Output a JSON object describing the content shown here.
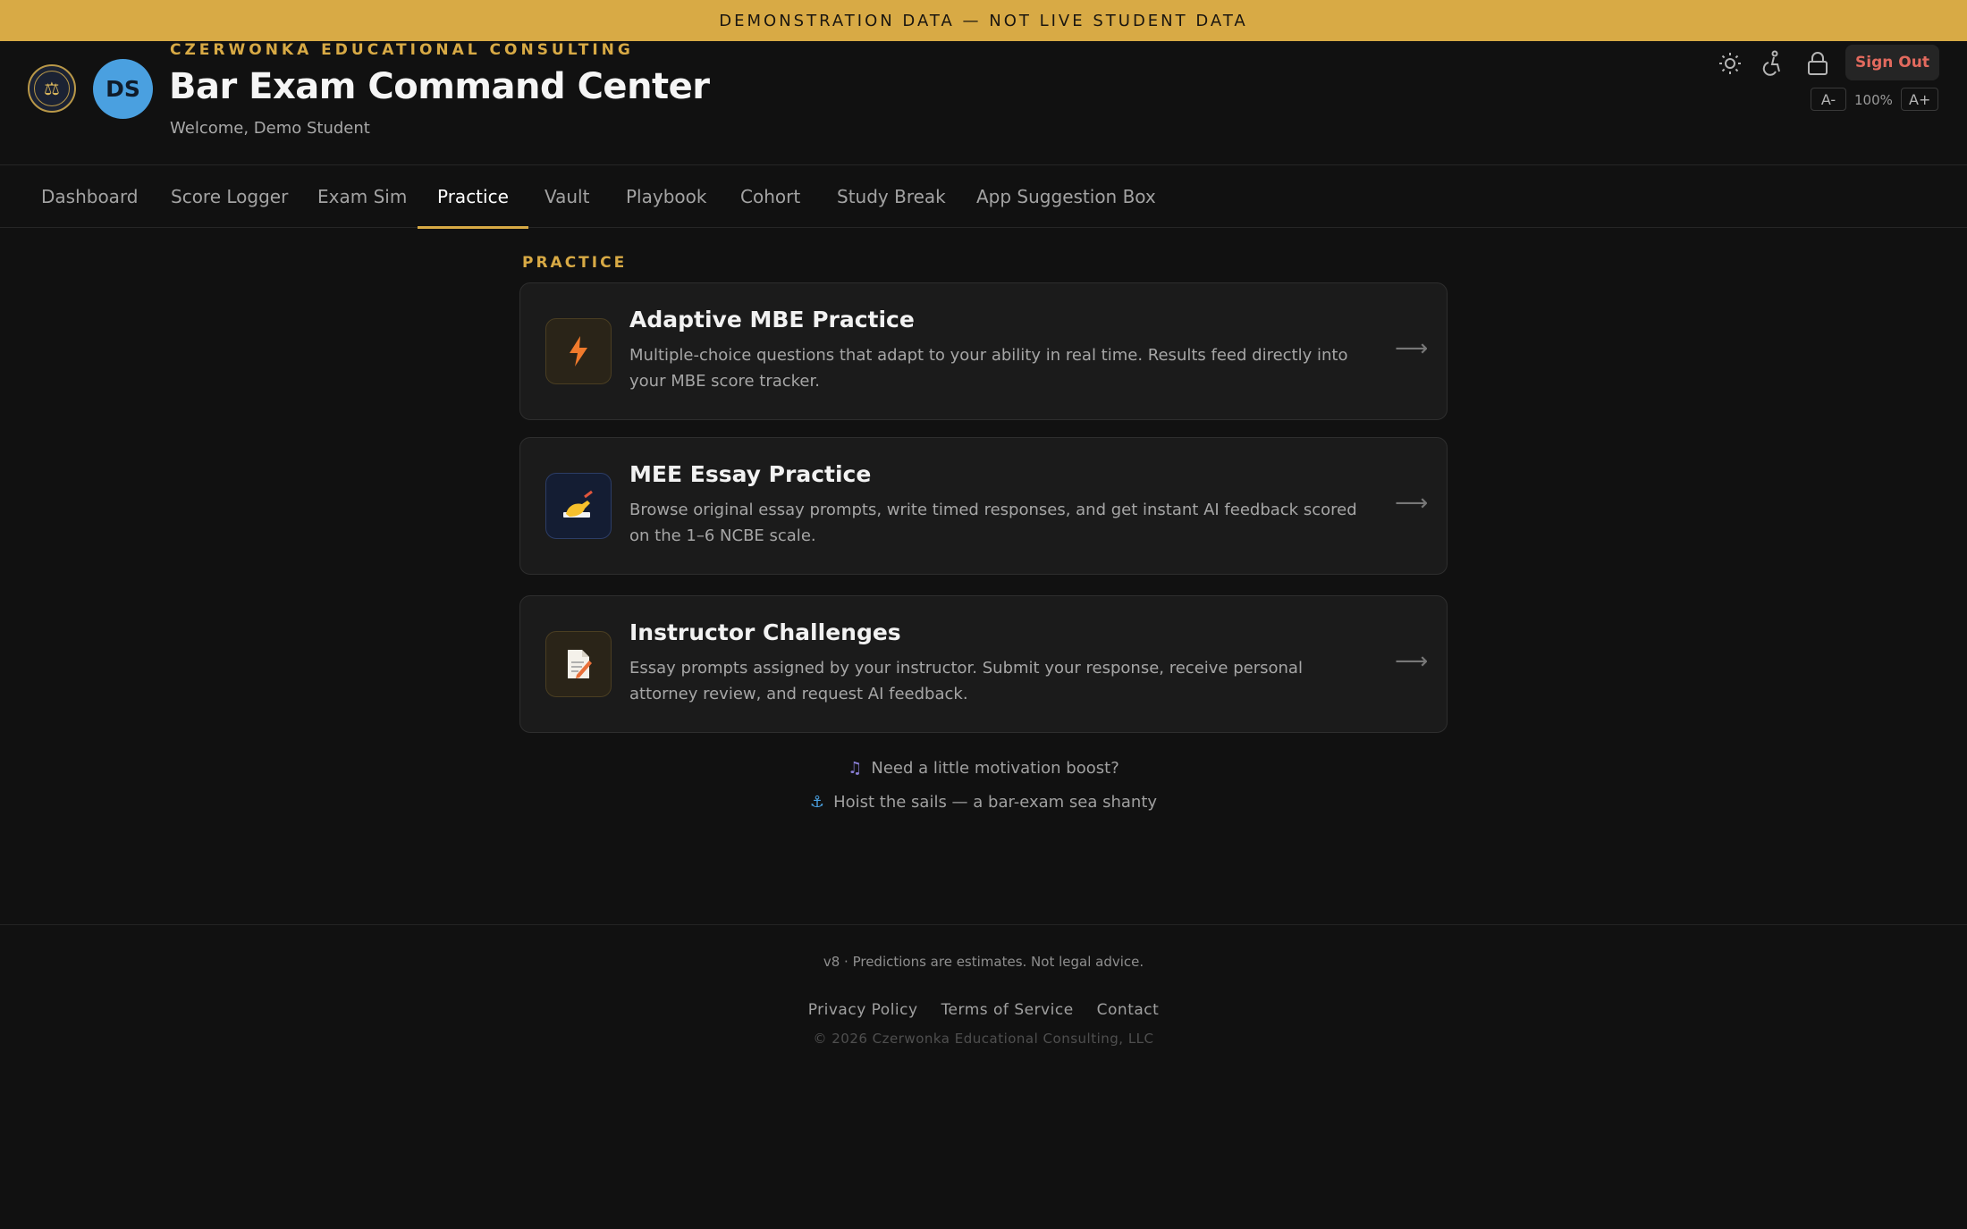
{
  "banner": {
    "text": "DEMONSTRATION DATA — NOT LIVE STUDENT DATA"
  },
  "header": {
    "org": "CZERWONKA EDUCATIONAL CONSULTING",
    "title": "Bar Exam Command Center",
    "welcome": "Welcome, Demo Student",
    "avatar_initials": "DS",
    "sign_out": "Sign Out",
    "font_decrease": "A-",
    "zoom_level": "100%",
    "font_increase": "A+",
    "icons": [
      "seal-logo",
      "sun-icon",
      "accessibility-icon",
      "lock-icon"
    ]
  },
  "nav": {
    "tabs": [
      {
        "label": "Dashboard"
      },
      {
        "label": "Score Logger"
      },
      {
        "label": "Exam Sim"
      },
      {
        "label": "Practice",
        "active": true
      },
      {
        "label": "Vault"
      },
      {
        "label": "Playbook"
      },
      {
        "label": "Cohort"
      },
      {
        "label": "Study Break"
      },
      {
        "label": "App Suggestion Box"
      }
    ]
  },
  "practice": {
    "section_label": "PRACTICE",
    "cards": [
      {
        "icon": "lightning-icon",
        "title": "Adaptive MBE Practice",
        "description": "Multiple-choice questions that adapt to your ability in real time. Results feed directly into your MBE score tracker."
      },
      {
        "icon": "writing-hand-icon",
        "title": "MEE Essay Practice",
        "description": "Browse original essay prompts, write timed responses, and get instant AI feedback scored on the 1–6 NCBE scale."
      },
      {
        "icon": "memo-icon",
        "title": "Instructor Challenges",
        "description": "Essay prompts assigned by your instructor. Submit your response, receive personal attorney review, and request AI feedback."
      }
    ],
    "arrow": "⟶"
  },
  "motivation": {
    "line1": "Need a little motivation boost?",
    "line2": "Hoist the sails — a bar-exam sea shanty"
  },
  "footer": {
    "version": "v8 · Predictions are estimates. Not legal advice.",
    "links": [
      "Privacy Policy",
      "Terms of Service",
      "Contact"
    ],
    "copyright": "© 2026 Czerwonka Educational Consulting, LLC"
  },
  "colors": {
    "background": "#111111",
    "accent_gold": "#d8aa45",
    "sign_out_red": "#e36a5e",
    "avatar_blue": "#4aa0e0"
  }
}
